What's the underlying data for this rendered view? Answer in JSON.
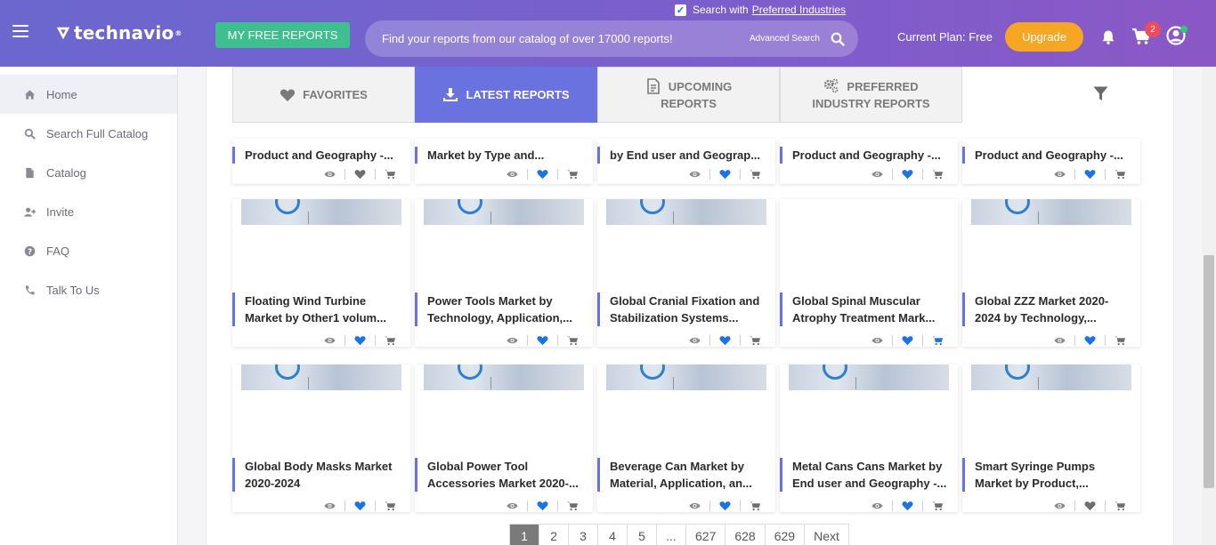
{
  "header": {
    "brand": "technavio",
    "trademark": "®",
    "free_reports_label": "MY FREE REPORTS",
    "preferred_label": "Search with",
    "preferred_link": "Preferred Industries",
    "search_placeholder": "Find your reports from our catalog of over 17000 reports!",
    "advanced_label": "Advanced Search",
    "plan_text": "Current Plan: Free",
    "upgrade_label": "Upgrade",
    "cart_count": "2"
  },
  "sidebar": {
    "items": [
      {
        "label": "Home",
        "icon": "home-icon"
      },
      {
        "label": "Search Full Catalog",
        "icon": "search-icon"
      },
      {
        "label": "Catalog",
        "icon": "document-icon"
      },
      {
        "label": "Invite",
        "icon": "user-plus-icon"
      },
      {
        "label": "FAQ",
        "icon": "question-icon"
      },
      {
        "label": "Talk To Us",
        "icon": "phone-icon"
      }
    ]
  },
  "tabs": [
    {
      "line1": "FAVORITES",
      "line2": "",
      "icon": "heart-icon"
    },
    {
      "line1": "LATEST REPORTS",
      "line2": "",
      "icon": "download-icon"
    },
    {
      "line1": "UPCOMING",
      "line2": "REPORTS",
      "icon": "document-icon"
    },
    {
      "line1": "PREFERRED",
      "line2": "INDUSTRY REPORTS",
      "icon": "gears-icon"
    }
  ],
  "cards": [
    {
      "l1": "Product and Geography -...",
      "l2": "",
      "fav": false,
      "cart": false
    },
    {
      "l1": "Market by Type and...",
      "l2": "",
      "fav": true,
      "cart": false
    },
    {
      "l1": "by End user and Geograp...",
      "l2": "",
      "fav": true,
      "cart": false
    },
    {
      "l1": "Product and Geography -...",
      "l2": "",
      "fav": true,
      "cart": false
    },
    {
      "l1": "Product and Geography -...",
      "l2": "",
      "fav": true,
      "cart": false
    },
    {
      "l1": "Floating Wind Turbine",
      "l2": "Market by Other1 volum...",
      "fav": true,
      "cart": false
    },
    {
      "l1": "Power Tools Market by",
      "l2": "Technology, Application,...",
      "fav": true,
      "cart": false
    },
    {
      "l1": "Global Cranial Fixation and",
      "l2": "Stabilization Systems...",
      "fav": true,
      "cart": false
    },
    {
      "l1": "Global Spinal Muscular",
      "l2": "Atrophy Treatment Mark...",
      "fav": true,
      "cart": true
    },
    {
      "l1": "Global ZZZ Market 2020-",
      "l2": "2024 by Technology,...",
      "fav": true,
      "cart": false
    },
    {
      "l1": "Global Body Masks Market",
      "l2": "2020-2024",
      "fav": true,
      "cart": false
    },
    {
      "l1": "Global Power Tool",
      "l2": "Accessories Market 2020-...",
      "fav": true,
      "cart": false
    },
    {
      "l1": "Beverage Can Market by",
      "l2": "Material, Application, an...",
      "fav": true,
      "cart": false
    },
    {
      "l1": "Metal Cans Cans Market by",
      "l2": "End user and Geography -...",
      "fav": true,
      "cart": false
    },
    {
      "l1": "Smart Syringe Pumps",
      "l2": "Market by Product,...",
      "fav": false,
      "cart": false
    }
  ],
  "pagination": [
    "1",
    "2",
    "3",
    "4",
    "5",
    "...",
    "627",
    "628",
    "629",
    "Next"
  ],
  "colors": {
    "accent": "#6a72e0",
    "fav_on": "#1a73e8",
    "fav_off": "#6e6e6e",
    "upgrade": "#f5a623",
    "free_reports": "#3fbf8f"
  }
}
